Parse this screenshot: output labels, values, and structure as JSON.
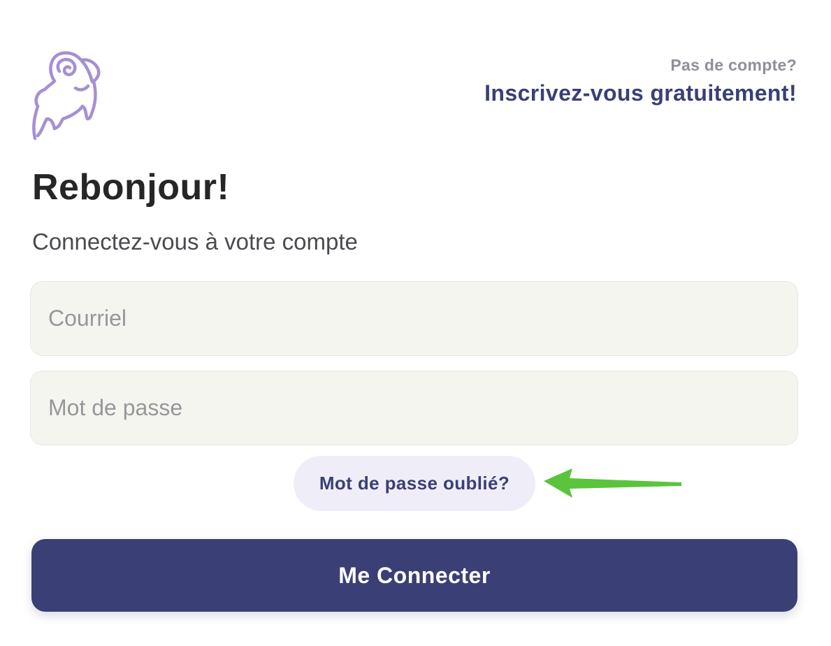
{
  "header": {
    "logo_icon": "ram-logo-icon",
    "signup_prompt": "Pas de compte?",
    "signup_link": "Inscrivez-vous gratuitement!"
  },
  "main": {
    "title": "Rebonjour!",
    "subtitle": "Connectez-vous à votre compte",
    "email": {
      "placeholder": "Courriel",
      "value": ""
    },
    "password": {
      "placeholder": "Mot de passe",
      "value": ""
    },
    "forgot_password_label": "Mot de passe oublié?",
    "submit_label": "Me Connecter"
  },
  "annotation": {
    "icon": "arrow-left-icon"
  },
  "colors": {
    "brand": "#3a3f76",
    "logo": "#a58fd6",
    "annotation_arrow": "#5ac43c",
    "field_background": "#f5f5f0"
  }
}
